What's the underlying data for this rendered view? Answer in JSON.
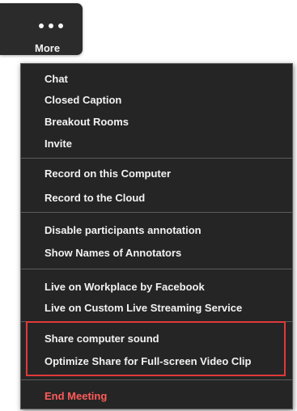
{
  "more_button": {
    "icon": "ellipsis-horizontal-icon",
    "label": "More"
  },
  "menu": {
    "groups": [
      {
        "items": [
          "Chat",
          "Closed Caption",
          "Breakout Rooms",
          "Invite"
        ]
      },
      {
        "items": [
          "Record on this Computer",
          "Record to the Cloud"
        ]
      },
      {
        "items": [
          "Disable participants annotation",
          "Show Names of Annotators"
        ]
      },
      {
        "items": [
          "Live on Workplace by Facebook",
          "Live on Custom Live Streaming Service"
        ]
      },
      {
        "items": [
          "Share computer sound",
          "Optimize Share for Full-screen Video Clip"
        ]
      },
      {
        "items": [
          "End Meeting"
        ]
      }
    ]
  },
  "colors": {
    "menu_background": "#252525",
    "menu_text": "#f2f2f2",
    "end_meeting_text": "#ff5b59",
    "highlight_border": "#e0393b"
  }
}
